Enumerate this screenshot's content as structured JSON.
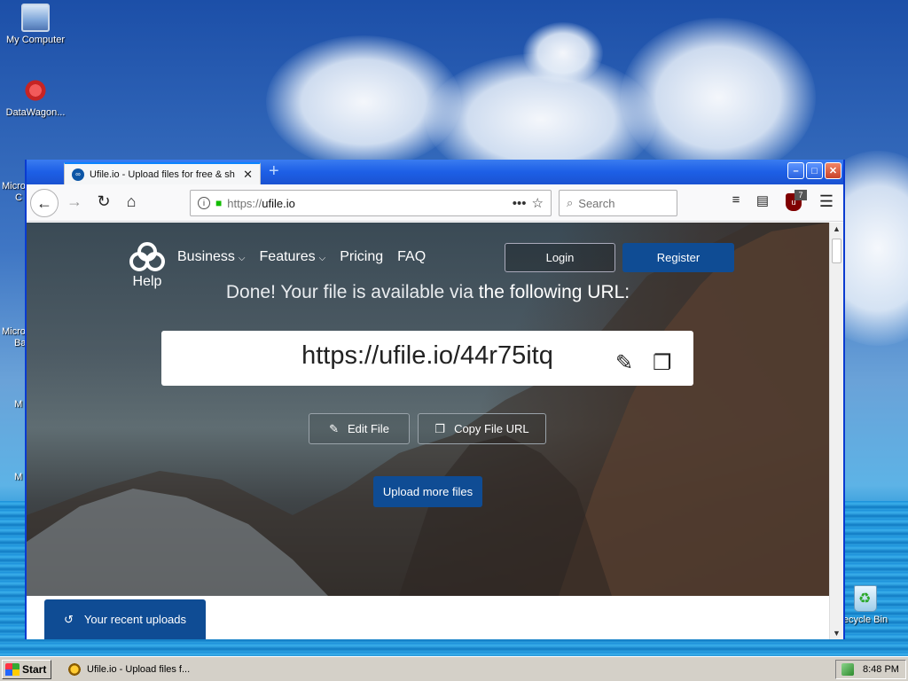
{
  "desktop": {
    "icons": [
      {
        "label": "My Computer"
      },
      {
        "label": "DataWagon..."
      },
      {
        "label": "ecycle Bin"
      }
    ],
    "partial_labels": [
      "Micro",
      "C",
      "Micro",
      "Ba",
      "M",
      "M"
    ]
  },
  "browser": {
    "tab": {
      "title": "Ufile.io - Upload files for free & sh",
      "favicon": "ufile-logo-icon"
    },
    "url": {
      "protocol": "https://",
      "host": "ufile.io"
    },
    "search_placeholder": "Search",
    "ublock_badge": "7"
  },
  "page": {
    "brand": {
      "label": "Help"
    },
    "menu": [
      {
        "label": "Business",
        "has_dropdown": true
      },
      {
        "label": "Features",
        "has_dropdown": true
      },
      {
        "label": "Pricing",
        "has_dropdown": false
      },
      {
        "label": "FAQ",
        "has_dropdown": false
      }
    ],
    "login_label": "Login",
    "register_label": "Register",
    "headline_prefix": "Done! Your file is available via ",
    "headline_emphasis": "the following URL:",
    "file_url": "https://ufile.io/44r75itq",
    "edit_label": "Edit File",
    "copy_label": "Copy File URL",
    "upload_more_label": "Upload more files",
    "recent_uploads_label": "Your recent uploads"
  },
  "taskbar": {
    "start_label": "Start",
    "task_label": "Ufile.io - Upload files f...",
    "clock": "8:48 PM"
  },
  "colors": {
    "brand_blue": "#0f4c94",
    "titlebar_blue": "#1d5fe6"
  }
}
